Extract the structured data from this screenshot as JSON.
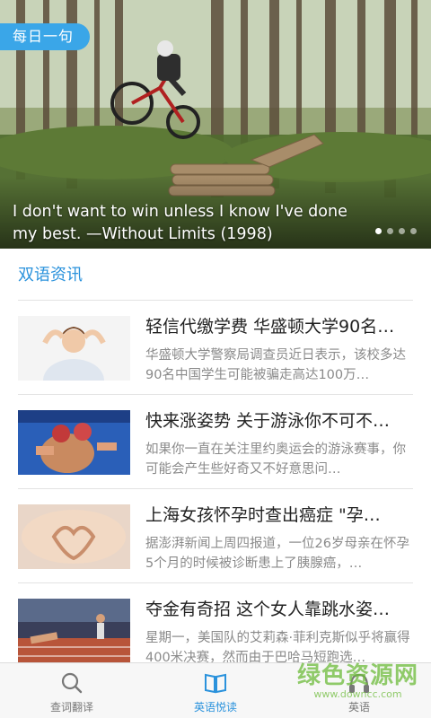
{
  "banner": {
    "tag": "每日一句",
    "quote": "I don't want to win unless I know I've done my best. —Without Limits (1998)",
    "dots": 4,
    "active_dot": 0
  },
  "section": {
    "title": "双语资讯"
  },
  "news": [
    {
      "title": "轻信代缴学费 华盛顿大学90名…",
      "summary": "华盛顿大学警察局调查员近日表示，该校多达90名中国学生可能被骗走高达100万…"
    },
    {
      "title": "快来涨姿势 关于游泳你不可不…",
      "summary": "如果你一直在关注里约奥运会的游泳赛事，你可能会产生些好奇又不好意思问…"
    },
    {
      "title": "上海女孩怀孕时查出癌症 \"孕…",
      "summary": "据澎湃新闻上周四报道，一位26岁母亲在怀孕5个月的时候被诊断患上了胰腺癌，…"
    },
    {
      "title": "夺金有奇招 这个女人靠跳水姿…",
      "summary": "星期一，美国队的艾莉森·菲利克斯似乎将赢得400米决赛，然而由于巴哈马短跑选…"
    }
  ],
  "bottom_nav": [
    {
      "label": "查词翻译",
      "icon": "search-icon"
    },
    {
      "label": "英语悦读",
      "icon": "book-icon"
    },
    {
      "label": "英语",
      "icon": "headphones-icon"
    }
  ],
  "active_tab": 1,
  "watermark": {
    "main": "绿色资源网",
    "sub": "www.downcc.com"
  },
  "colors": {
    "accent": "#2a92dc",
    "tag_bg": "#3aa6e8",
    "summary": "#8a8a8a"
  }
}
